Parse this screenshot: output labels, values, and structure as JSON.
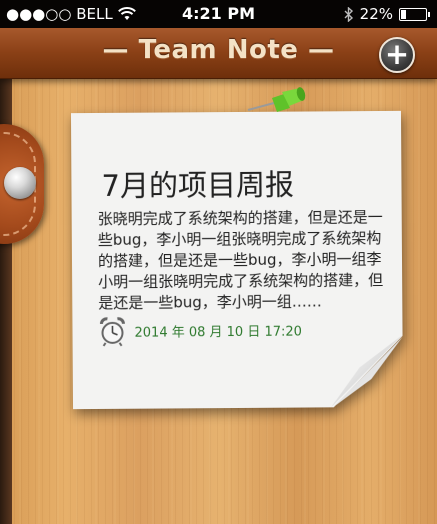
{
  "status_bar": {
    "carrier": "●●●○○ BELL",
    "time": "4:21 PM",
    "battery": "22%",
    "battery_level": 0.22,
    "icons": [
      "wifi-icon",
      "bluetooth-icon",
      "battery-icon"
    ]
  },
  "nav": {
    "title": "— Team Note —",
    "add_button": "+"
  },
  "note": {
    "title": "7月的项目周报",
    "body": "张晓明完成了系统架构的搭建，但是还是一些bug，李小明一组张晓明完成了系统架构的搭建，但是还是一些bug，李小明一组李小明一组张晓明完成了系统架构的搭建，但是还是一些bug，李小明一组……",
    "date": "2014 年 08 月 10 日 17:20",
    "icons": [
      "alarm-clock-icon",
      "pushpin-icon"
    ]
  },
  "colors": {
    "nav_brown": "#8a4016",
    "title_text": "#f4e2c6",
    "date_green": "#2f7a2f",
    "paper": "#f3f3f2"
  }
}
